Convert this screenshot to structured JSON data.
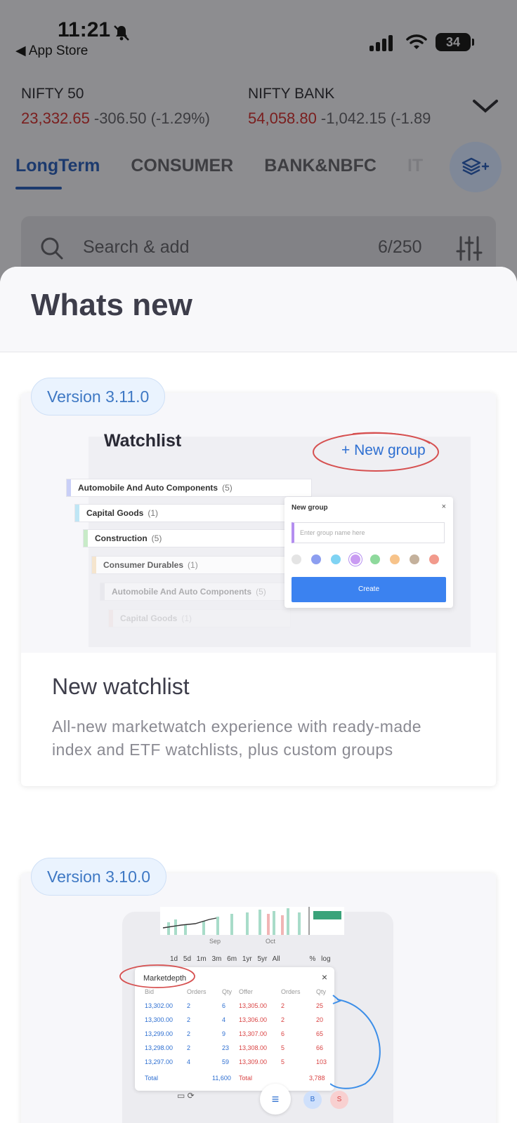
{
  "status_bar": {
    "time": "11:21",
    "back_label": "◀ App Store",
    "battery": "34"
  },
  "indices": [
    {
      "name": "NIFTY 50",
      "price": "23,332.65",
      "change": "-306.50 (-1.29%)"
    },
    {
      "name": "NIFTY BANK",
      "price": "54,058.80",
      "change": "-1,042.15 (-1.89"
    }
  ],
  "tabs": [
    {
      "label": "LongTerm"
    },
    {
      "label": "CONSUMER"
    },
    {
      "label": "BANK&NBFC"
    },
    {
      "label": "IT"
    }
  ],
  "search": {
    "placeholder": "Search & add",
    "count": "6/250"
  },
  "sheet": {
    "title": "Whats new",
    "items": [
      {
        "version": "Version 3.11.0",
        "title": "New watchlist",
        "description": "All-new marketwatch experience with ready-made index and ETF watchlists, plus custom groups",
        "illustration": {
          "heading": "Watchlist",
          "new_group_link": "+ New group",
          "groups": [
            {
              "name": "Automobile And Auto Components",
              "count": "(5)"
            },
            {
              "name": "Capital Goods",
              "count": "(1)"
            },
            {
              "name": "Construction",
              "count": "(5)"
            },
            {
              "name": "Consumer Durables",
              "count": "(1)"
            },
            {
              "name": "Automobile And Auto Components",
              "count": "(5)"
            },
            {
              "name": "Capital Goods",
              "count": "(1)"
            }
          ],
          "popup": {
            "title": "New group",
            "close": "×",
            "placeholder": "Enter group name here",
            "button": "Create",
            "colors": [
              "#e4e4e4",
              "#8c9ef0",
              "#7fd3f3",
              "#c99bf2",
              "#8ed99c",
              "#f7c38a",
              "#c4b19c",
              "#f29a8c"
            ]
          }
        }
      },
      {
        "version": "Version 3.10.0",
        "illustration": {
          "axis_labels": [
            "Sep",
            "Oct"
          ],
          "ranges": "1d 5d 1m 3m 6m 1yr 5yr All",
          "extra_controls": "% log",
          "panel_title": "Marketdepth",
          "close": "×",
          "headers": [
            "Bid",
            "Orders",
            "Qty",
            "Offer",
            "Orders",
            "Qty"
          ],
          "rows": [
            [
              "13,302.00",
              "2",
              "6",
              "13,305.00",
              "2",
              "25"
            ],
            [
              "13,300.00",
              "2",
              "4",
              "13,306.00",
              "2",
              "20"
            ],
            [
              "13,299.00",
              "2",
              "9",
              "13,307.00",
              "6",
              "65"
            ],
            [
              "13,298.00",
              "2",
              "23",
              "13,308.00",
              "5",
              "66"
            ],
            [
              "13,297.00",
              "4",
              "59",
              "13,309.00",
              "5",
              "103"
            ]
          ],
          "totals": [
            "Total",
            "11,600",
            "Total",
            "3,788"
          ],
          "buy_label": "B",
          "sell_label": "S"
        }
      }
    ]
  },
  "colors": {
    "accent": "#3e78c4",
    "negative": "#d94343",
    "primary_button": "#3b82f0"
  }
}
